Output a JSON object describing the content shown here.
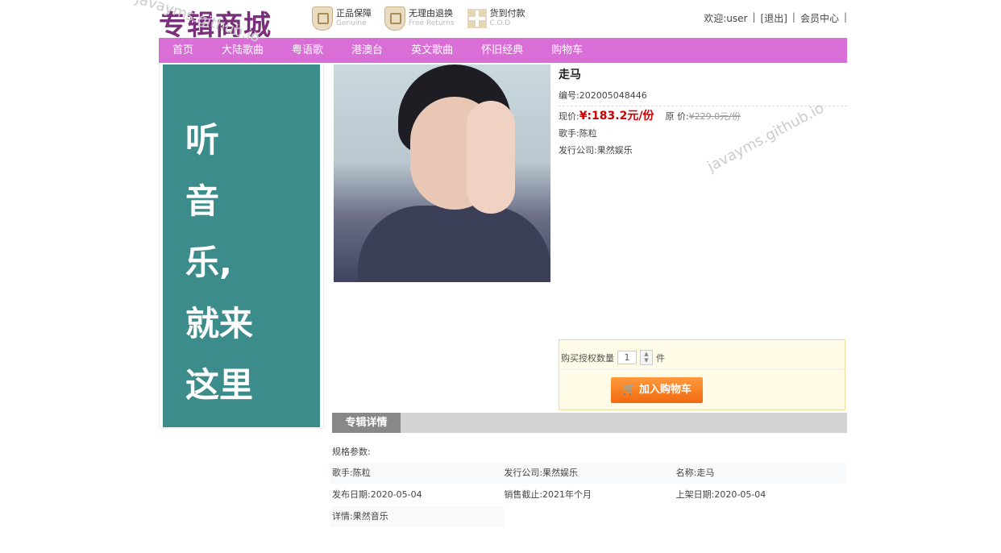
{
  "header": {
    "logo": "专辑商城",
    "badges": [
      {
        "title": "正品保障",
        "subtitle": "Genuine",
        "icon": "shield-icon"
      },
      {
        "title": "无理由退换",
        "subtitle": "Free Returns",
        "icon": "shield-icon"
      },
      {
        "title": "货到付款",
        "subtitle": "C.O.D",
        "icon": "plus-icon"
      }
    ],
    "user": {
      "welcome": "欢迎:user",
      "logout": "[退出]",
      "member": "会员中心",
      "sep": "|"
    }
  },
  "nav": [
    "首页",
    "大陆歌曲",
    "粤语歌",
    "港澳台",
    "英文歌曲",
    "怀旧经典",
    "购物车"
  ],
  "banner": {
    "lines": [
      "听",
      "音",
      "乐,",
      "就来",
      "这里"
    ]
  },
  "product": {
    "name": "走马",
    "code": "编号:202005048446",
    "price_label": "现价:",
    "price": "¥:183.2元/份",
    "orig_label": "原 价:",
    "orig_price": "¥229.0元/份",
    "singer": "歌手:陈粒",
    "company": "发行公司:果然娱乐"
  },
  "buy": {
    "qty_label": "购买授权数量",
    "qty": "1",
    "unit": "件",
    "add_cart": "加入购物车"
  },
  "details": {
    "tab": "专辑详情",
    "spec_title": "规格参数:",
    "rows": [
      [
        "歌手:陈粒",
        "发行公司:果然娱乐",
        "名称:走马"
      ],
      [
        "发布日期:2020-05-04",
        "销售截止:2021年个月",
        "上架日期:2020-05-04"
      ],
      [
        "详情:果然音乐",
        "",
        ""
      ]
    ]
  },
  "watermark": "javayms.github.io"
}
